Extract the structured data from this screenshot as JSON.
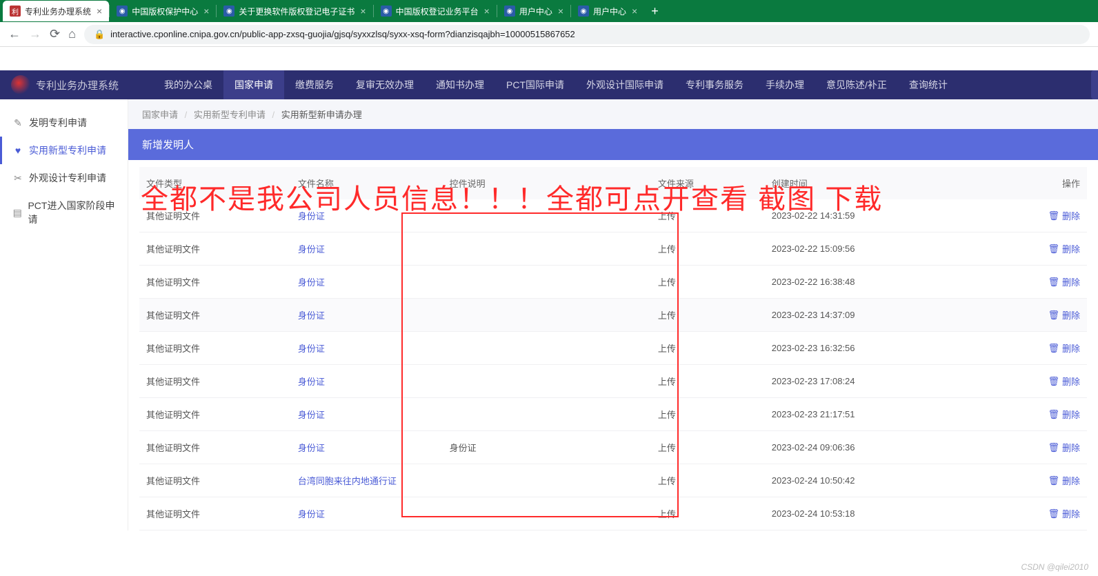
{
  "browser": {
    "tabs": [
      {
        "title": "专利业务办理系统",
        "active": true
      },
      {
        "title": "中国版权保护中心",
        "active": false
      },
      {
        "title": "关于更换软件版权登记电子证书",
        "active": false
      },
      {
        "title": "中国版权登记业务平台",
        "active": false
      },
      {
        "title": "用户中心",
        "active": false
      },
      {
        "title": "用户中心",
        "active": false
      }
    ],
    "url": "interactive.cponline.cnipa.gov.cn/public-app-zxsq-guojia/gjsq/syxxzlsq/syxx-xsq-form?dianzisqajbh=10000515867652"
  },
  "app": {
    "brand": "专利业务办理系统",
    "nav": [
      "我的办公桌",
      "国家申请",
      "缴费服务",
      "复审无效办理",
      "通知书办理",
      "PCT国际申请",
      "外观设计国际申请",
      "专利事务服务",
      "手续办理",
      "意见陈述/补正",
      "查询统计"
    ],
    "nav_active_index": 1
  },
  "sidebar": {
    "items": [
      {
        "icon": "✎",
        "label": "发明专利申请"
      },
      {
        "icon": "♥",
        "label": "实用新型专利申请"
      },
      {
        "icon": "✂",
        "label": "外观设计专利申请"
      },
      {
        "icon": "▤",
        "label": "PCT进入国家阶段申请"
      }
    ],
    "active_index": 1
  },
  "breadcrumb": {
    "a": "国家申请",
    "b": "实用新型专利申请",
    "c": "实用新型新申请办理"
  },
  "dialog": {
    "title": "新增发明人"
  },
  "overlay": "全都不是我公司人员信息！！！全都可点开查看 截图 下载",
  "table": {
    "headers": [
      "文件类型",
      "文件名称",
      "控件说明",
      "文件来源",
      "创建时间",
      "操作"
    ],
    "delete_label": "删除",
    "rows": [
      {
        "type": "其他证明文件",
        "name": "身份证",
        "note": "",
        "src": "上传",
        "time": "2023-02-22 14:31:59"
      },
      {
        "type": "其他证明文件",
        "name": "身份证",
        "note": "",
        "src": "上传",
        "time": "2023-02-22 15:09:56"
      },
      {
        "type": "其他证明文件",
        "name": "身份证",
        "note": "",
        "src": "上传",
        "time": "2023-02-22 16:38:48"
      },
      {
        "type": "其他证明文件",
        "name": "身份证",
        "note": "",
        "src": "上传",
        "time": "2023-02-23 14:37:09"
      },
      {
        "type": "其他证明文件",
        "name": "身份证",
        "note": "",
        "src": "上传",
        "time": "2023-02-23 16:32:56"
      },
      {
        "type": "其他证明文件",
        "name": "身份证",
        "note": "",
        "src": "上传",
        "time": "2023-02-23 17:08:24"
      },
      {
        "type": "其他证明文件",
        "name": "身份证",
        "note": "",
        "src": "上传",
        "time": "2023-02-23 21:17:51"
      },
      {
        "type": "其他证明文件",
        "name": "身份证",
        "note": "身份证",
        "src": "上传",
        "time": "2023-02-24 09:06:36"
      },
      {
        "type": "其他证明文件",
        "name": "台湾同胞来往内地通行证",
        "note": "",
        "src": "上传",
        "time": "2023-02-24 10:50:42"
      },
      {
        "type": "其他证明文件",
        "name": "身份证",
        "note": "",
        "src": "上传",
        "time": "2023-02-24 10:53:18"
      }
    ]
  },
  "watermark": "CSDN @qilei2010"
}
